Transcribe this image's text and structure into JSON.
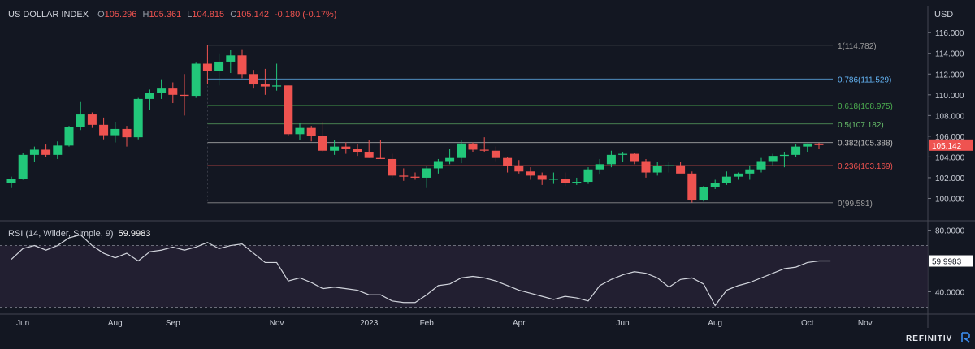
{
  "instrument": {
    "name": "US DOLLAR INDEX",
    "o_label": "O",
    "o_value": "105.296",
    "h_label": "H",
    "h_value": "105.361",
    "l_label": "L",
    "l_value": "104.815",
    "c_label": "C",
    "c_value": "105.142",
    "change": "-0.180 (-0.17%)"
  },
  "currency_label": "USD",
  "brand": "REFINITIV",
  "colors": {
    "up": "#26a69a",
    "up_bright": "#22c77a",
    "down": "#ef5350",
    "background": "#131722",
    "rsi_line": "#d1d4dc"
  },
  "chart_data": [
    {
      "type": "candlestick",
      "title": "US DOLLAR INDEX",
      "ylim": [
        98.0,
        116.8
      ],
      "y_ticks": [
        "116.000",
        "114.000",
        "112.000",
        "110.000",
        "108.000",
        "106.000",
        "104.000",
        "102.000",
        "100.000"
      ],
      "y_tick_values": [
        116,
        114,
        112,
        110,
        108,
        106,
        104,
        102,
        100
      ],
      "last_price_label": "105.142",
      "last_price": 105.142,
      "x_labels": [
        "Jun",
        "Aug",
        "Sep",
        "Nov",
        "2023",
        "Feb",
        "Apr",
        "Jun",
        "Aug",
        "Oct",
        "Nov"
      ],
      "x_label_weeks": [
        1,
        9,
        14,
        23,
        31,
        36,
        44,
        53,
        61,
        69,
        74
      ],
      "candles": [
        [
          101.5,
          102.1,
          101.0,
          101.9
        ],
        [
          101.9,
          104.4,
          101.8,
          104.2
        ],
        [
          104.2,
          105.0,
          103.5,
          104.7
        ],
        [
          104.7,
          105.2,
          104.0,
          104.2
        ],
        [
          104.2,
          105.5,
          103.8,
          105.1
        ],
        [
          105.1,
          107.0,
          105.0,
          106.9
        ],
        [
          106.9,
          109.3,
          106.6,
          108.1
        ],
        [
          108.1,
          108.3,
          106.8,
          107.1
        ],
        [
          107.1,
          107.8,
          105.7,
          106.1
        ],
        [
          106.1,
          107.4,
          105.4,
          106.7
        ],
        [
          106.7,
          107.0,
          105.0,
          105.9
        ],
        [
          105.9,
          109.7,
          105.7,
          109.6
        ],
        [
          109.6,
          110.5,
          108.5,
          110.2
        ],
        [
          110.2,
          111.5,
          109.6,
          110.6
        ],
        [
          110.6,
          111.2,
          109.2,
          110.0
        ],
        [
          110.0,
          112.0,
          108.0,
          109.9
        ],
        [
          109.9,
          113.1,
          109.7,
          113.0
        ],
        [
          113.0,
          114.8,
          111.0,
          112.3
        ],
        [
          112.3,
          114.0,
          110.9,
          113.2
        ],
        [
          113.2,
          114.3,
          112.1,
          113.8
        ],
        [
          113.8,
          114.4,
          111.6,
          112.0
        ],
        [
          112.0,
          112.4,
          110.6,
          111.0
        ],
        [
          111.0,
          112.5,
          110.0,
          110.8
        ],
        [
          110.8,
          113.0,
          110.4,
          110.9
        ],
        [
          110.9,
          110.9,
          106.0,
          106.2
        ],
        [
          106.2,
          107.3,
          105.6,
          106.8
        ],
        [
          106.8,
          107.0,
          105.5,
          106.0
        ],
        [
          106.0,
          107.4,
          104.5,
          104.6
        ],
        [
          104.6,
          105.6,
          104.2,
          105.0
        ],
        [
          105.0,
          105.4,
          104.3,
          104.8
        ],
        [
          104.8,
          105.2,
          104.1,
          104.5
        ],
        [
          104.5,
          105.6,
          103.9,
          103.9
        ],
        [
          103.9,
          105.6,
          103.8,
          103.8
        ],
        [
          103.8,
          104.3,
          102.0,
          102.2
        ],
        [
          102.2,
          102.9,
          101.7,
          102.1
        ],
        [
          102.1,
          102.5,
          101.8,
          102.0
        ],
        [
          102.0,
          103.1,
          101.0,
          102.9
        ],
        [
          102.9,
          103.8,
          102.4,
          103.6
        ],
        [
          103.6,
          104.8,
          103.3,
          103.9
        ],
        [
          103.9,
          105.6,
          103.4,
          105.3
        ],
        [
          105.3,
          105.4,
          104.5,
          104.7
        ],
        [
          104.7,
          105.9,
          104.5,
          104.6
        ],
        [
          104.6,
          105.0,
          103.6,
          103.9
        ],
        [
          103.9,
          104.0,
          102.5,
          103.1
        ],
        [
          103.1,
          103.7,
          102.4,
          102.6
        ],
        [
          102.6,
          103.0,
          101.8,
          102.2
        ],
        [
          102.2,
          102.5,
          101.3,
          101.8
        ],
        [
          101.8,
          102.5,
          101.4,
          101.9
        ],
        [
          101.9,
          102.5,
          101.2,
          101.5
        ],
        [
          101.5,
          102.0,
          101.3,
          101.6
        ],
        [
          101.6,
          103.0,
          101.4,
          102.8
        ],
        [
          102.8,
          103.8,
          102.3,
          103.3
        ],
        [
          103.3,
          104.6,
          103.0,
          104.2
        ],
        [
          104.2,
          104.5,
          103.5,
          104.3
        ],
        [
          104.3,
          104.4,
          103.3,
          103.6
        ],
        [
          103.6,
          103.8,
          102.0,
          102.5
        ],
        [
          102.5,
          103.5,
          102.2,
          103.1
        ],
        [
          103.1,
          103.5,
          102.5,
          103.2
        ],
        [
          103.2,
          103.5,
          102.5,
          102.4
        ],
        [
          102.4,
          102.6,
          99.6,
          99.8
        ],
        [
          99.8,
          101.2,
          99.7,
          101.1
        ],
        [
          101.1,
          101.8,
          100.9,
          101.5
        ],
        [
          101.5,
          102.6,
          101.3,
          102.1
        ],
        [
          102.1,
          102.5,
          101.8,
          102.4
        ],
        [
          102.4,
          103.2,
          101.8,
          102.8
        ],
        [
          102.8,
          103.9,
          102.5,
          103.6
        ],
        [
          103.6,
          104.3,
          103.2,
          104.1
        ],
        [
          104.1,
          104.5,
          103.0,
          104.2
        ],
        [
          104.2,
          105.2,
          104.0,
          105.0
        ],
        [
          105.0,
          105.3,
          104.5,
          105.3
        ],
        [
          105.296,
          105.361,
          104.815,
          105.142
        ]
      ],
      "fib_levels": [
        {
          "ratio": 1,
          "value": 114.782,
          "label": "1(114.782)",
          "color": "#9e9e9e"
        },
        {
          "ratio": 0.786,
          "value": 111.529,
          "label": "0.786(111.529)",
          "color": "#64b5f6"
        },
        {
          "ratio": 0.618,
          "value": 108.975,
          "label": "0.618(108.975)",
          "color": "#4caf50"
        },
        {
          "ratio": 0.5,
          "value": 107.182,
          "label": "0.5(107.182)",
          "color": "#66bb6a"
        },
        {
          "ratio": 0.382,
          "value": 105.388,
          "label": "0.382(105.388)",
          "color": "#bdbdbd"
        },
        {
          "ratio": 0.236,
          "value": 103.169,
          "label": "0.236(103.169)",
          "color": "#ef5350"
        },
        {
          "ratio": 0,
          "value": 99.581,
          "label": "0(99.581)",
          "color": "#9e9e9e"
        }
      ],
      "fib_start_week": 17
    },
    {
      "type": "line",
      "title": "RSI (14, Wilder, Simple, 9)",
      "last_value_label": "59.9983",
      "last_value": 59.9983,
      "ylim": [
        26,
        84
      ],
      "y_ticks": [
        "80.0000",
        "40.0000"
      ],
      "y_tick_values": [
        80,
        40
      ],
      "bands": [
        70,
        30
      ],
      "values": [
        61,
        68,
        70,
        67,
        70,
        75,
        77,
        70,
        65,
        62,
        65,
        60,
        66,
        67,
        69,
        67,
        69,
        72,
        68,
        70,
        71,
        65,
        59,
        59,
        47,
        49,
        46,
        42,
        43,
        42,
        41,
        38,
        38,
        34,
        33,
        33,
        38,
        44,
        45,
        49,
        50,
        49,
        47,
        44,
        41,
        39,
        37,
        35,
        37,
        36,
        34,
        44,
        48,
        51,
        53,
        52,
        49,
        43,
        48,
        49,
        45,
        31,
        41,
        44,
        46,
        49,
        52,
        55,
        56,
        59,
        60,
        59.9983
      ]
    }
  ],
  "rsi_title_text": "RSI (14, Wilder, Simple, 9)"
}
